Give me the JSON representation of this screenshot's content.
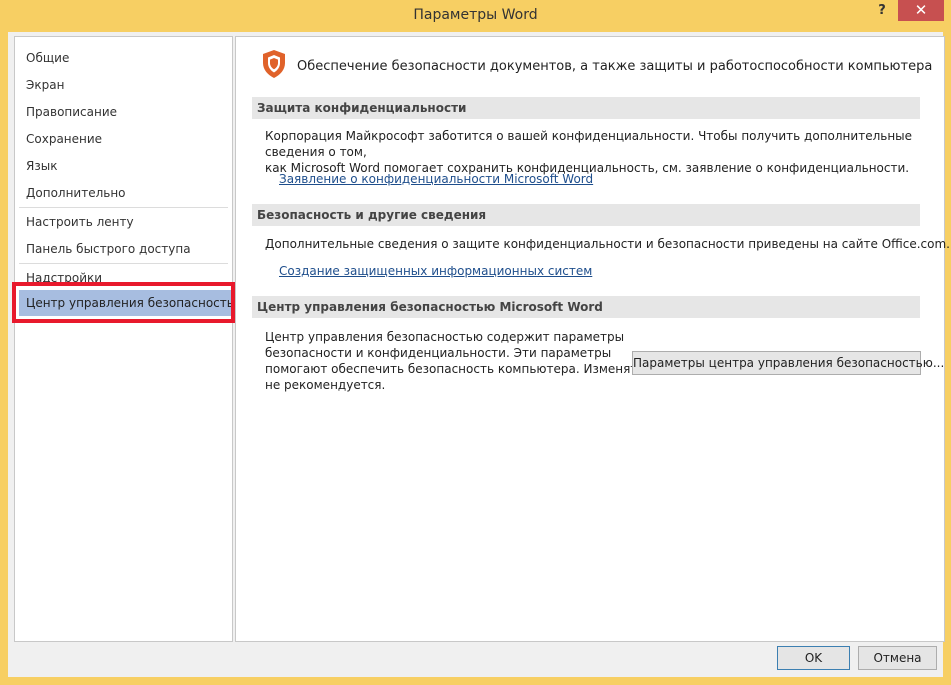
{
  "window": {
    "title": "Параметры Word",
    "help_glyph": "?",
    "close_glyph": "✕",
    "accent_color": "#f7cf63",
    "close_color": "#c75050"
  },
  "sidebar": {
    "items": [
      {
        "label": "Общие"
      },
      {
        "label": "Экран"
      },
      {
        "label": "Правописание"
      },
      {
        "label": "Сохранение"
      },
      {
        "label": "Язык"
      },
      {
        "label": "Дополнительно"
      },
      {
        "label": "Настроить ленту"
      },
      {
        "label": "Панель быстрого доступа"
      },
      {
        "label": "Надстройки"
      },
      {
        "label": "Центр управления безопасностью"
      }
    ],
    "selected_index": 9,
    "selected_color": "#a7bde0",
    "highlight_color": "#e8192c"
  },
  "main": {
    "header_icon": "shield-icon",
    "header_text": "Обеспечение безопасности документов, а также защиты и работоспособности компьютера",
    "sections": [
      {
        "title": "Защита конфиденциальности",
        "text_line1": "Корпорация Майкрософт заботится о вашей конфиденциальности. Чтобы получить дополнительные сведения о том,",
        "text_line2": "как Microsoft Word помогает сохранить конфиденциальность, см. заявление о конфиденциальности.",
        "link": "Заявление о конфиденциальности Microsoft Word"
      },
      {
        "title": "Безопасность и другие сведения",
        "text_line1": "Дополнительные сведения о защите конфиденциальности и безопасности приведены на сайте Office.com.",
        "link": "Создание защищенных информационных систем"
      },
      {
        "title": "Центр управления безопасностью Microsoft Word",
        "text_line1": "Центр управления безопасностью содержит параметры",
        "text_line2": "безопасности и конфиденциальности. Эти параметры",
        "text_line3": "помогают обеспечить безопасность компьютера. Изменять их",
        "text_line4": "не рекомендуется.",
        "button": "Параметры центра управления безопасностью..."
      }
    ],
    "link_color": "#1e4e8c"
  },
  "footer": {
    "ok_label": "OK",
    "cancel_label": "Отмена"
  }
}
